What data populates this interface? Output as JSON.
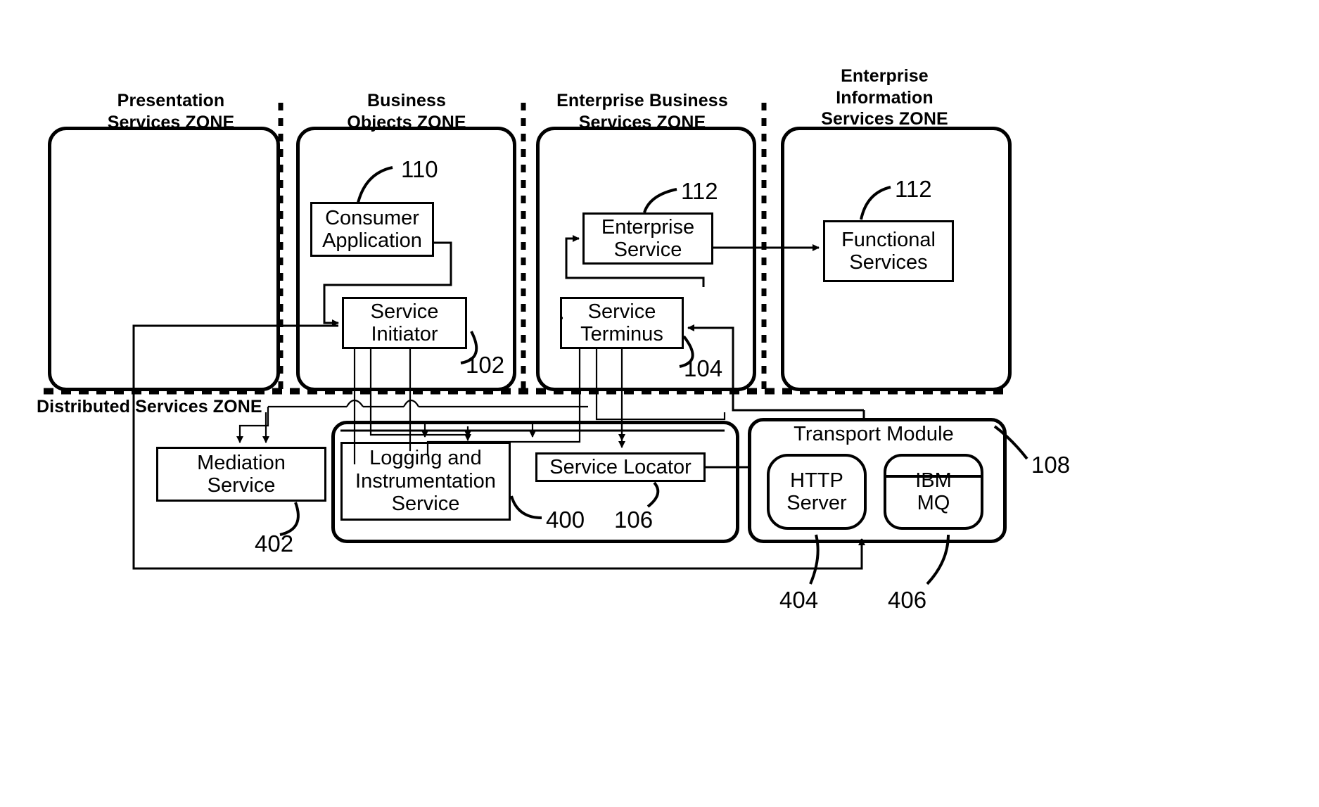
{
  "figure": {
    "zones": [
      {
        "id": "presentation",
        "title": "Presentation\nServices ZONE"
      },
      {
        "id": "business",
        "title": "Business\nObjects ZONE"
      },
      {
        "id": "enterprise",
        "title": "Enterprise Business\nServices ZONE"
      },
      {
        "id": "information",
        "title": "Enterprise\nInformation\nServices ZONE"
      }
    ],
    "distributed_zone_label": "Distributed Services ZONE",
    "nodes": {
      "consumer_application": "Consumer\nApplication",
      "service_initiator": "Service\nInitiator",
      "enterprise_service": "Enterprise\nService",
      "service_terminus": "Service\nTerminus",
      "functional_services": "Functional\nServices",
      "mediation_service": "Mediation\nService",
      "logging_service": "Logging and\nInstrumentation\nService",
      "service_locator": "Service Locator",
      "transport_module": "Transport Module",
      "http_server": "HTTP\nServer",
      "ibm_mq": "IBM\nMQ"
    },
    "reference_numerals": {
      "consumer_application": "110",
      "service_initiator": "102",
      "enterprise_service": "112",
      "functional_services": "112",
      "service_terminus": "104",
      "mediation_service": "402",
      "logging_service": "400",
      "service_locator": "106",
      "transport_module": "108",
      "http_server": "404",
      "ibm_mq": "406"
    }
  }
}
